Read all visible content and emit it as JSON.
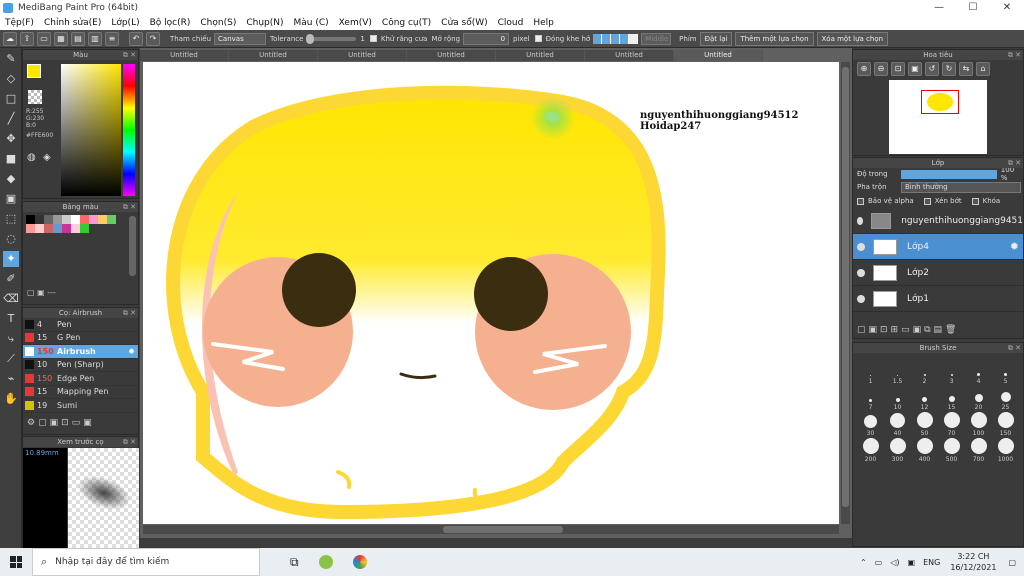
{
  "window": {
    "title": "MediBang Paint Pro (64bit)"
  },
  "menu": [
    "Tệp(F)",
    "Chỉnh sửa(E)",
    "Lớp(L)",
    "Bộ lọc(R)",
    "Chọn(S)",
    "Chụp(N)",
    "Màu (C)",
    "Xem(V)",
    "Công cụ(T)",
    "Cửa sổ(W)",
    "Cloud",
    "Help"
  ],
  "toolbar": {
    "ref_label": "Tham chiếu",
    "ref_value": "Canvas",
    "tolerance_label": "Tolerance",
    "tolerance_value": "1",
    "antialias_label": "Khử răng cưa",
    "expand_label": "Mở rộng",
    "expand_value": "0",
    "pixel_label": "pixel",
    "close_gap_label": "Đóng khe hở",
    "gap_value": "Middle",
    "key_label": "Phím",
    "reset_label": "Đặt lại",
    "add_sel_label": "Thêm một lựa chọn",
    "del_sel_label": "Xóa một lựa chọn"
  },
  "color_panel": {
    "title": "Màu",
    "r": "R:255",
    "g": "G:230",
    "b": "B:0",
    "hex": "#FFE600",
    "accent": "#FFE600"
  },
  "palette_panel": {
    "title": "Bảng màu",
    "footer": "---"
  },
  "brush_panel": {
    "title": "Cọ: Airbrush",
    "items": [
      {
        "size": "4",
        "name": "Pen",
        "color": "#111111"
      },
      {
        "size": "15",
        "name": "G Pen",
        "color": "#e53935"
      },
      {
        "size": "150",
        "name": "Airbrush",
        "color": "#6aaee8"
      },
      {
        "size": "10",
        "name": "Pen (Sharp)",
        "color": "#111111"
      },
      {
        "size": "150",
        "name": "Edge Pen",
        "color": "#e53935"
      },
      {
        "size": "15",
        "name": "Mapping Pen",
        "color": "#e53935"
      },
      {
        "size": "19",
        "name": "Sumi",
        "color": "#d4c400"
      }
    ]
  },
  "preview_panel": {
    "title": "Xem trước cọ",
    "size": "10.89mm"
  },
  "tabs": [
    "Untitled",
    "Untitled",
    "Untitled",
    "Untitled",
    "Untitled",
    "Untitled",
    "Untitled"
  ],
  "canvas": {
    "watermark1": "nguyenthihuonggiang94512",
    "watermark2": "Hoidap247"
  },
  "navigator": {
    "title": "Hoa tiêu"
  },
  "layer_panel": {
    "title": "Lớp",
    "opacity_label": "Độ trong",
    "opacity_value": "100 %",
    "blend_label": "Pha trộn",
    "blend_value": "Bình thường",
    "protect_alpha": "Bảo vệ alpha",
    "clip": "Xén bớt",
    "lock": "Khóa",
    "layers": [
      "nguyenthihuonggiang9451",
      "Lớp4",
      "Lớp2",
      "Lớp1"
    ]
  },
  "brush_size_panel": {
    "title": "Brush Size",
    "sizes": [
      "1",
      "1.5",
      "2",
      "3",
      "4",
      "5",
      "7",
      "10",
      "12",
      "15",
      "20",
      "25",
      "30",
      "40",
      "50",
      "70",
      "100",
      "150",
      "200",
      "300",
      "400",
      "500",
      "700",
      "1000"
    ]
  },
  "taskbar": {
    "search_placeholder": "Nhập tại đây để tìm kiếm",
    "lang": "ENG",
    "time": "3:22 CH",
    "date": "16/12/2021"
  }
}
